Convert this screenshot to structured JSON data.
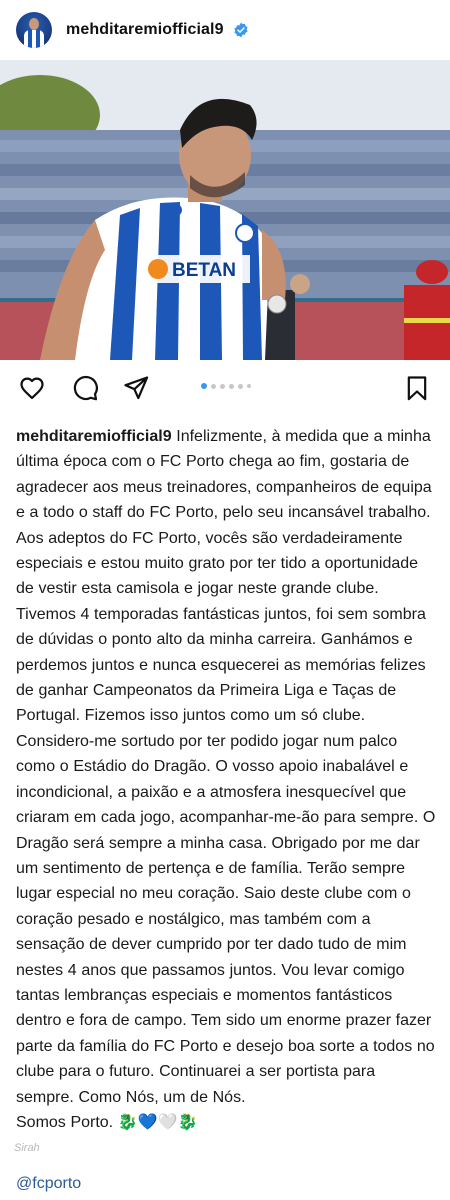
{
  "post": {
    "username": "mehditaremiofficial9",
    "caption_user": "mehditaremiofficial9",
    "caption_text": "Infelizmente, à medida que a minha última época com o FC Porto chega ao fim, gostaria de agradecer aos meus treinadores, companheiros de equipa e a todo o staff do FC Porto, pelo seu incansável trabalho. Aos adeptos do FC Porto, vocês são verdadeiramente especiais e estou muito grato por ter tido a oportunidade de vestir esta camisola e jogar neste grande clube. Tivemos 4 temporadas fantásticas juntos, foi sem sombra de dúvidas o ponto alto da minha carreira. Ganhámos e perdemos juntos e nunca esquecerei as memórias felizes de ganhar Campeonatos da Primeira Liga e Taças de Portugal. Fizemos isso juntos como um só clube. Considero-me sortudo por ter podido jogar num palco como o Estádio do Dragão. O vosso apoio inabalável e incondicional, a paixão e a atmosfera inesquecível que criaram em cada jogo, acompanhar-me-ão para sempre. O Dragão será sempre a minha casa. Obrigado por me dar um sentimento de pertença e de família. Terão sempre lugar especial no meu coração. Saio deste clube com o coração pesado e nostálgico, mas também com a sensação de dever cumprido por ter dado tudo de mim nestes 4 anos que passamos juntos. Vou levar comigo tantas lembranças especiais e momentos fantásticos dentro e fora de campo. Tem sido um enorme prazer fazer parte da família do FC Porto e desejo boa sorte a todos no clube para o futuro. Continuarei a ser portista para sempre. Como Nós, um de Nós.",
    "sign_off": "Somos Porto.",
    "sign_off_emojis": "🐉💙🤍🐉",
    "mention": "@fcporto",
    "watermark": "Sirah",
    "jersey_sponsor": "BETAN",
    "carousel": {
      "total": 6,
      "current": 1
    }
  },
  "icons": {
    "verified": "verified-badge-icon",
    "like": "heart-icon",
    "comment": "comment-icon",
    "share": "send-icon",
    "save": "bookmark-icon"
  },
  "colors": {
    "verified": "#3897f0",
    "active_dot": "#3897f0",
    "mention": "#2a5a9c",
    "jersey_blue": "#1d58b8"
  }
}
